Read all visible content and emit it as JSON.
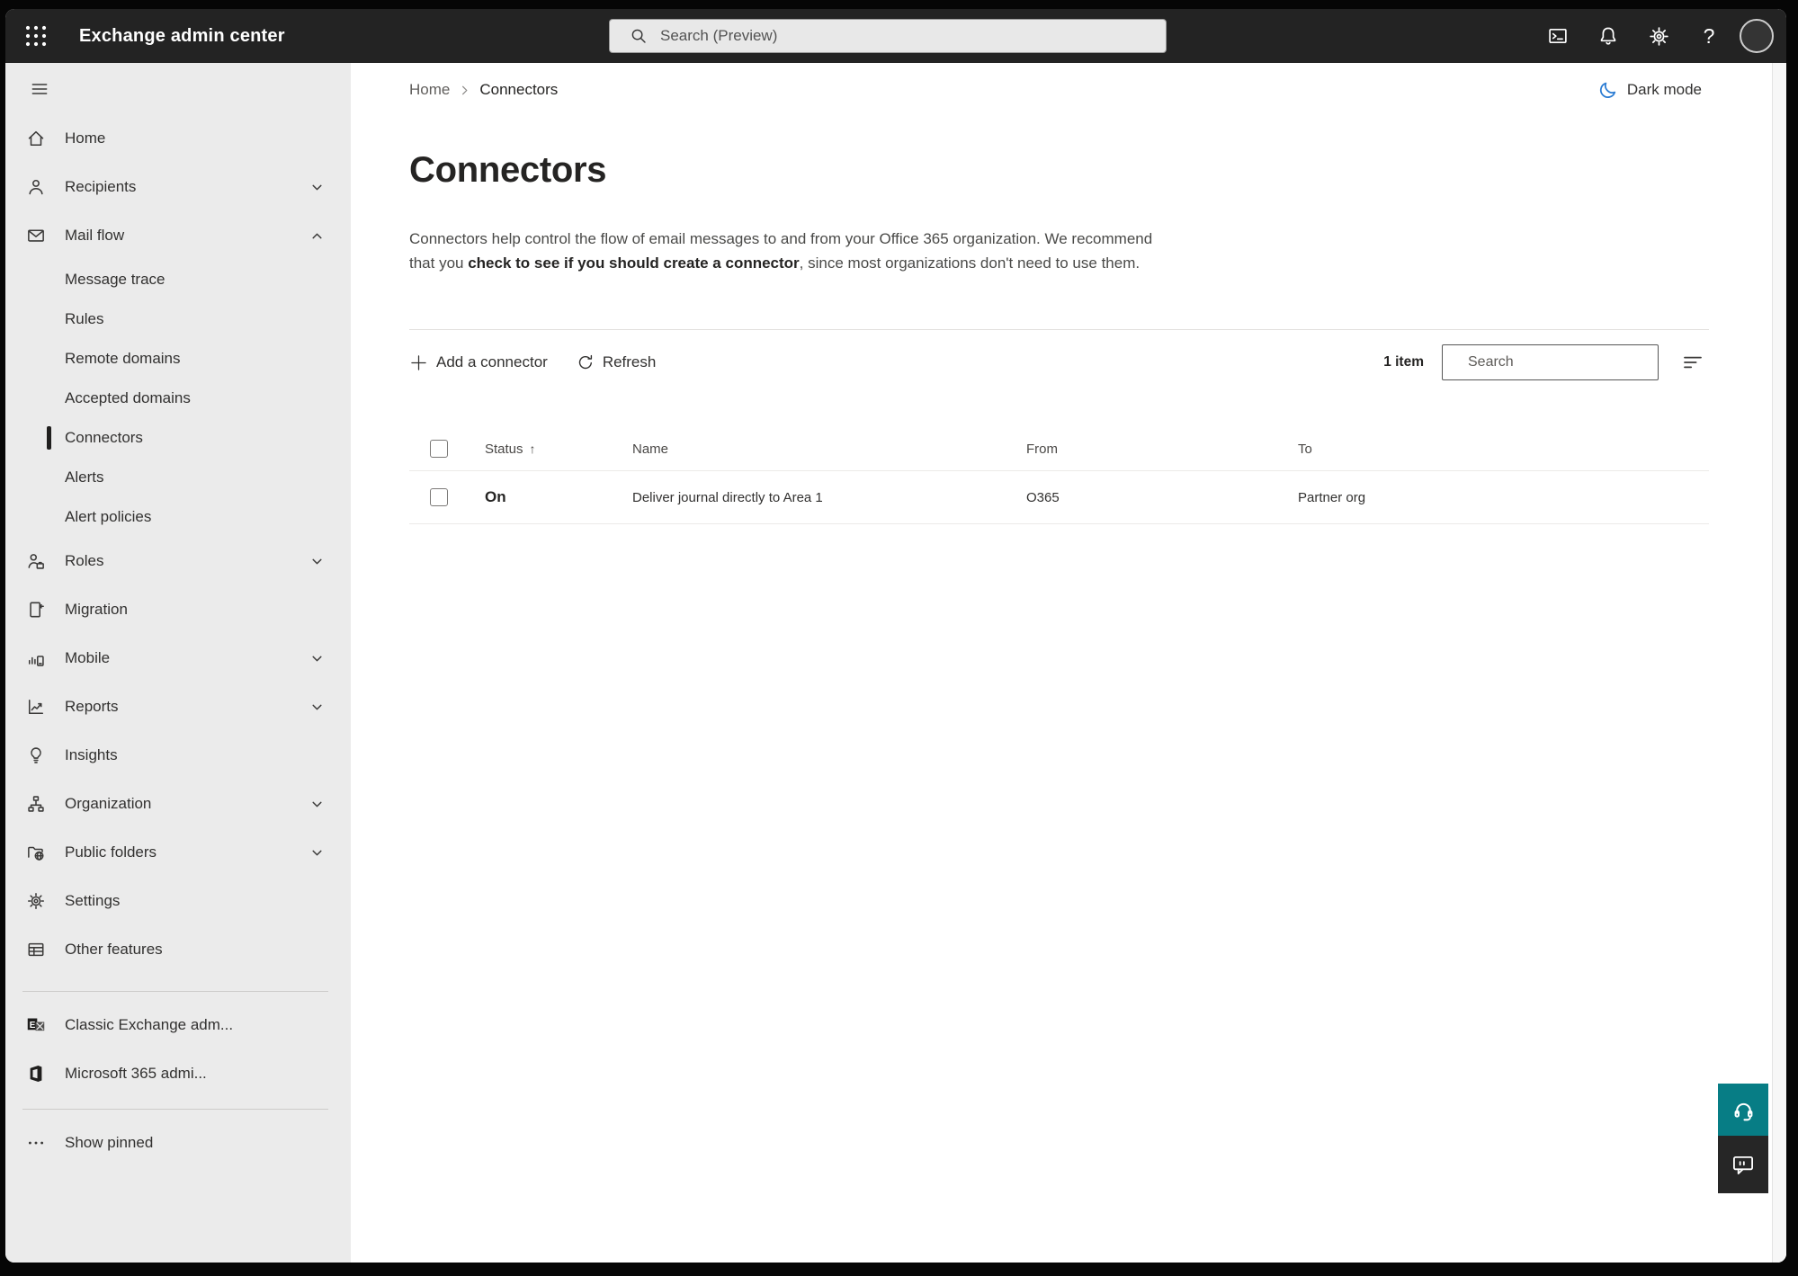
{
  "topbar": {
    "title": "Exchange admin center",
    "search_placeholder": "Search (Preview)",
    "help_glyph": "?",
    "icons": [
      "app-launcher-icon",
      "terminal-icon",
      "bell-icon",
      "gear-icon",
      "help-icon",
      "avatar"
    ]
  },
  "sidebar": {
    "items": [
      {
        "label": "Home",
        "icon": "home-icon"
      },
      {
        "label": "Recipients",
        "icon": "person-icon",
        "chevron": "down"
      },
      {
        "label": "Mail flow",
        "icon": "mail-icon",
        "chevron": "up",
        "expanded": true
      },
      {
        "label": "Message trace",
        "sub": true
      },
      {
        "label": "Rules",
        "sub": true
      },
      {
        "label": "Remote domains",
        "sub": true
      },
      {
        "label": "Accepted domains",
        "sub": true
      },
      {
        "label": "Connectors",
        "sub": true,
        "selected": true
      },
      {
        "label": "Alerts",
        "sub": true
      },
      {
        "label": "Alert policies",
        "sub": true
      },
      {
        "label": "Roles",
        "icon": "roles-icon",
        "chevron": "down"
      },
      {
        "label": "Migration",
        "icon": "migration-icon"
      },
      {
        "label": "Mobile",
        "icon": "mobile-icon",
        "chevron": "down"
      },
      {
        "label": "Reports",
        "icon": "reports-icon",
        "chevron": "down"
      },
      {
        "label": "Insights",
        "icon": "lightbulb-icon"
      },
      {
        "label": "Organization",
        "icon": "org-chart-icon",
        "chevron": "down"
      },
      {
        "label": "Public folders",
        "icon": "folder-globe-icon",
        "chevron": "down"
      },
      {
        "label": "Settings",
        "icon": "gear-icon"
      },
      {
        "label": "Other features",
        "icon": "table-icon"
      },
      {
        "label": "Classic Exchange adm...",
        "icon": "exchange-logo"
      },
      {
        "label": "Microsoft 365 admi...",
        "icon": "m365-logo"
      },
      {
        "label": "Show pinned",
        "icon": "ellipsis-icon"
      }
    ]
  },
  "breadcrumb": {
    "home": "Home",
    "current": "Connectors"
  },
  "darkmode_label": "Dark mode",
  "page": {
    "title": "Connectors",
    "desc_part1": "Connectors help control the flow of email messages to and from your Office 365 organization. We recommend that you ",
    "desc_link": "check to see if you should create a connector",
    "desc_part2": ", since most organizations don't need to use them."
  },
  "toolbar": {
    "add_label": "Add a connector",
    "refresh_label": "Refresh",
    "item_count": "1 item",
    "search_placeholder": "Search"
  },
  "table": {
    "sort_arrow": "↑",
    "columns": [
      "Status",
      "Name",
      "From",
      "To"
    ],
    "rows": [
      {
        "status": "On",
        "name": "Deliver journal directly to Area 1",
        "from": "O365",
        "to": "Partner org"
      }
    ]
  },
  "colors": {
    "topbar_bg": "#232323",
    "sidebar_bg": "#ebebeb",
    "accent_blue": "#2b7cd3",
    "selected_indicator": "#201f1e",
    "help_button_teal": "#077d85",
    "feedback_button_dark": "#262626"
  }
}
